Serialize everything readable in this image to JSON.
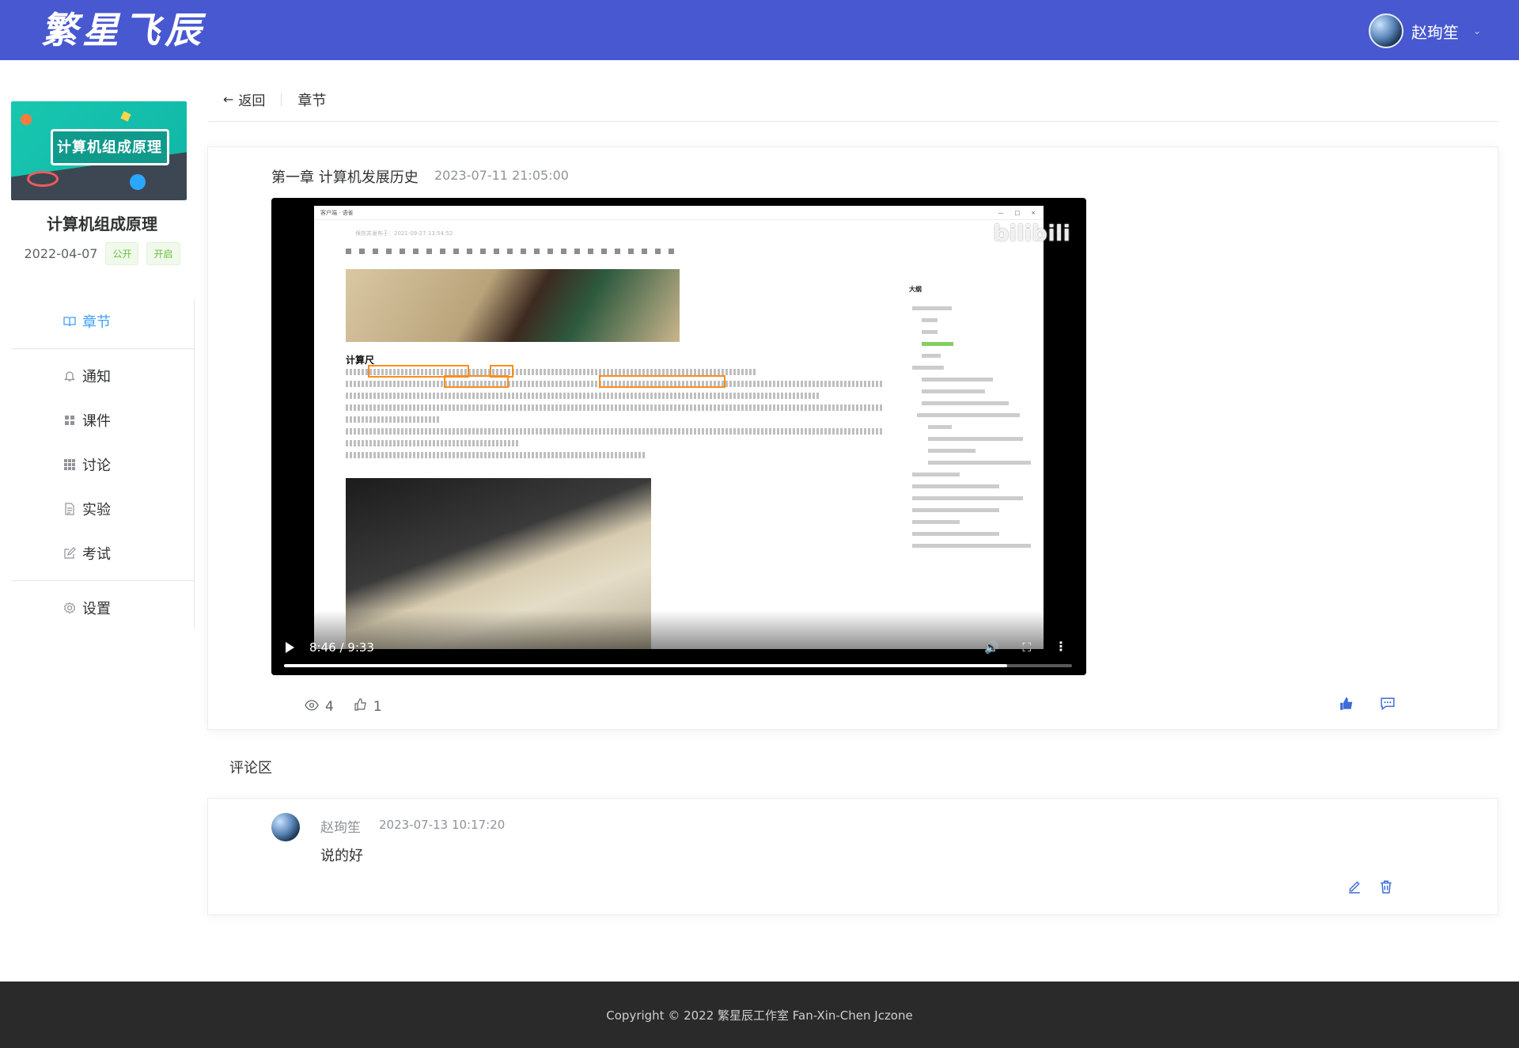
{
  "header": {
    "logo_text": "繁星飞辰",
    "user_name": "赵珣笙"
  },
  "course": {
    "cover_text": "计算机组成原理",
    "title": "计算机组成原理",
    "date": "2022-04-07",
    "tags": [
      "公开",
      "开启"
    ]
  },
  "nav": {
    "items": [
      {
        "label": "章节",
        "icon": "book-icon",
        "active": true
      },
      {
        "label": "通知",
        "icon": "bell-icon"
      },
      {
        "label": "课件",
        "icon": "grid-icon"
      },
      {
        "label": "讨论",
        "icon": "apps-icon"
      },
      {
        "label": "实验",
        "icon": "document-icon"
      },
      {
        "label": "考试",
        "icon": "edit-icon"
      },
      {
        "label": "设置",
        "icon": "gear-icon"
      }
    ]
  },
  "page_head": {
    "back_label": "返回",
    "title": "章节"
  },
  "chapter": {
    "title": "第一章 计算机发展历史",
    "date": "2023-07-11 21:05:00",
    "video": {
      "time_display": "8:46 / 9:33",
      "progress": 0.918,
      "watermark": "bilibili",
      "inner_window_title": "客户端 · 语雀",
      "inner_save_line": "保存并发布于：2021-09-27 13:54:52",
      "inner_heading": "计算尺",
      "inner_outline_title": "大纲"
    },
    "views": "4",
    "likes": "1"
  },
  "comments": {
    "header": "评论区",
    "items": [
      {
        "author": "赵珣笙",
        "time": "2023-07-13 10:17:20",
        "body": "说的好"
      }
    ]
  },
  "footer": {
    "copyright": "Copyright © 2022 繁星辰工作室 Fan-Xin-Chen Jczone"
  },
  "colors": {
    "header_bg": "#4758d0",
    "accent": "#409eff",
    "tag_green": "#67c23a",
    "footer_bg": "#2a2a2a"
  }
}
